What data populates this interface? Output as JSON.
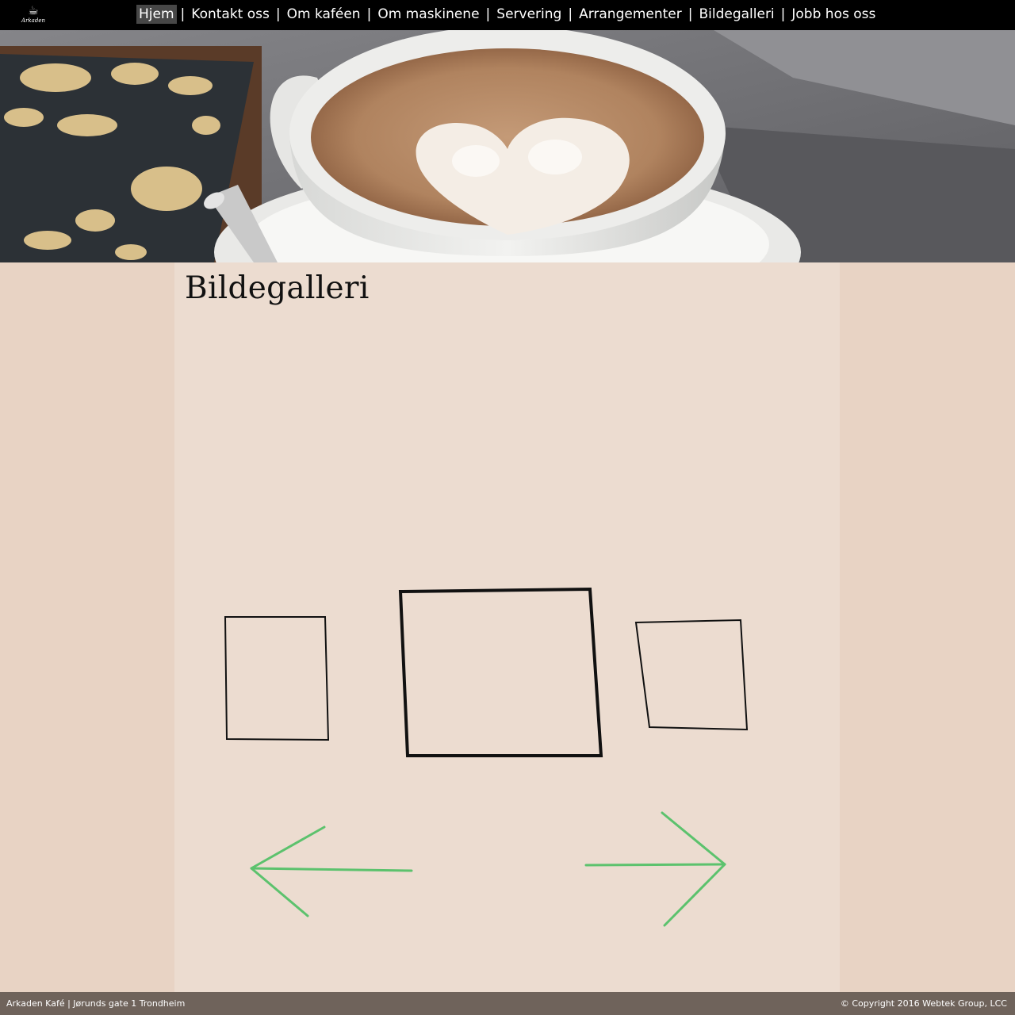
{
  "header": {
    "logo_text": "Arkaden",
    "nav": [
      {
        "label": "Hjem",
        "active": true
      },
      {
        "label": "Kontakt oss"
      },
      {
        "label": "Om kaféen"
      },
      {
        "label": "Om maskinene"
      },
      {
        "label": "Servering"
      },
      {
        "label": "Arrangementer"
      },
      {
        "label": "Bildegalleri"
      },
      {
        "label": "Jobb hos oss"
      }
    ],
    "separator": "|"
  },
  "page": {
    "title": "Bildegalleri"
  },
  "gallery": {
    "frames": [
      "frame-left",
      "frame-center",
      "frame-right"
    ],
    "prev_icon": "arrow-left-icon",
    "next_icon": "arrow-right-icon",
    "arrow_color": "#5cc26d"
  },
  "footer": {
    "left": "Arkaden Kafé | Jørunds gate 1 Trondheim",
    "right": "© Copyright 2016 Webtek Group, LCC"
  }
}
